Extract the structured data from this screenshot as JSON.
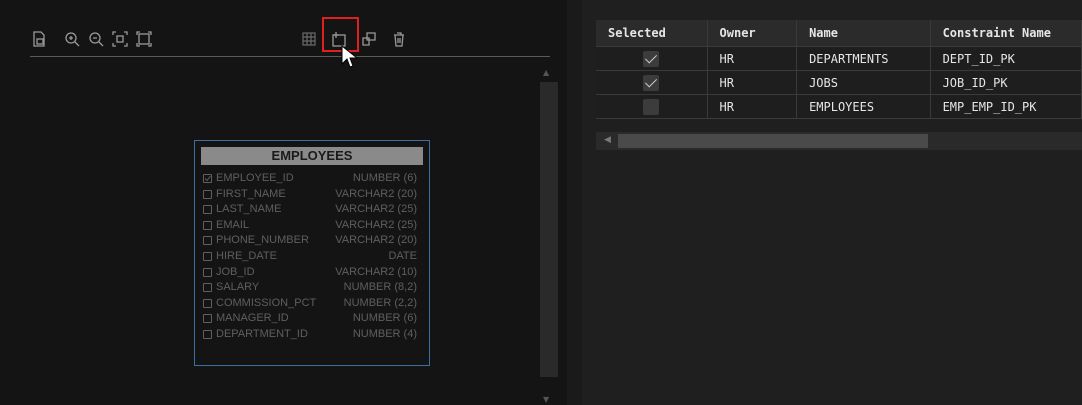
{
  "entity": {
    "title": "EMPLOYEES",
    "columns": [
      {
        "name": "EMPLOYEE_ID",
        "type": "NUMBER (6)",
        "checked": true
      },
      {
        "name": "FIRST_NAME",
        "type": "VARCHAR2 (20)",
        "checked": false
      },
      {
        "name": "LAST_NAME",
        "type": "VARCHAR2 (25)",
        "checked": false
      },
      {
        "name": "EMAIL",
        "type": "VARCHAR2 (25)",
        "checked": false
      },
      {
        "name": "PHONE_NUMBER",
        "type": "VARCHAR2 (20)",
        "checked": false
      },
      {
        "name": "HIRE_DATE",
        "type": "DATE",
        "checked": false
      },
      {
        "name": "JOB_ID",
        "type": "VARCHAR2 (10)",
        "checked": false
      },
      {
        "name": "SALARY",
        "type": "NUMBER (8,2)",
        "checked": false
      },
      {
        "name": "COMMISSION_PCT",
        "type": "NUMBER (2,2)",
        "checked": false
      },
      {
        "name": "MANAGER_ID",
        "type": "NUMBER (6)",
        "checked": false
      },
      {
        "name": "DEPARTMENT_ID",
        "type": "NUMBER (4)",
        "checked": false
      }
    ]
  },
  "grid": {
    "headers": [
      "Selected",
      "Owner",
      "Name",
      "Constraint Name"
    ],
    "rows": [
      {
        "selected": true,
        "owner": "HR",
        "name": "DEPARTMENTS",
        "constraint": "DEPT_ID_PK"
      },
      {
        "selected": true,
        "owner": "HR",
        "name": "JOBS",
        "constraint": "JOB_ID_PK"
      },
      {
        "selected": false,
        "owner": "HR",
        "name": "EMPLOYEES",
        "constraint": "EMP_EMP_ID_PK"
      }
    ]
  },
  "toolbar": {
    "icons": [
      "export-image-icon",
      "zoom-in-icon",
      "zoom-out-icon",
      "fit-to-screen-icon",
      "actual-size-icon",
      "grid-icon",
      "add-table-icon",
      "copy-icon",
      "delete-icon"
    ]
  }
}
